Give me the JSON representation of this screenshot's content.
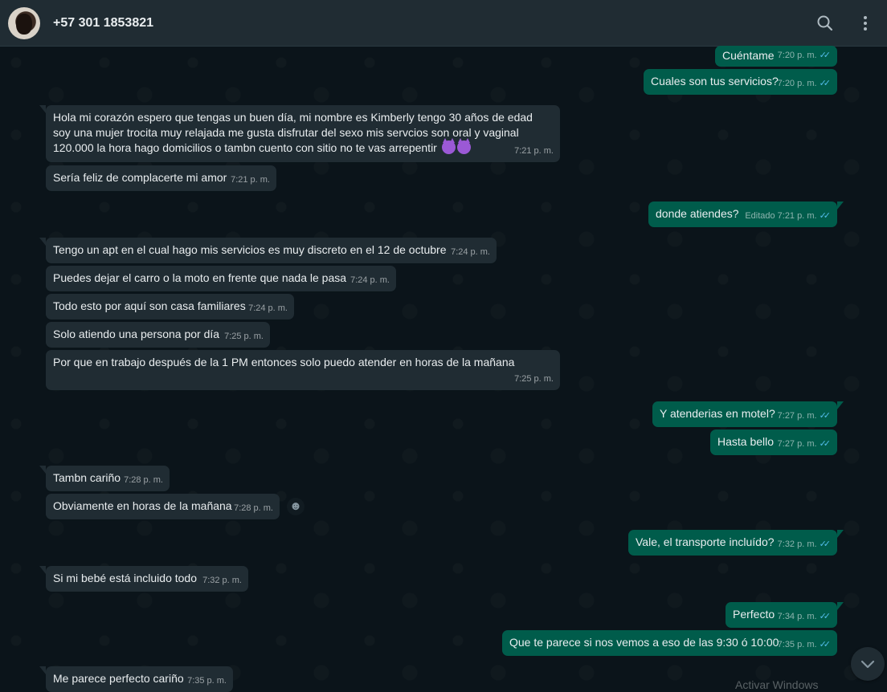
{
  "header": {
    "contact_name": "+57 301 1853821",
    "icons": [
      "search-icon",
      "menu-icon"
    ]
  },
  "messages": [
    {
      "dir": "out",
      "text": "Cuéntame",
      "time": "7:20 p. m."
    },
    {
      "dir": "out",
      "text": "Cuales son tus servicios?",
      "time": "7:20 p. m."
    },
    {
      "dir": "in",
      "text": "Hola mi corazón espero que tengas un buen día, mi nombre es Kimberly tengo 30 años de edad soy una mujer trocita muy relajada me gusta disfrutar del sexo mis servcios son oral y vaginal 120.000 la hora hago domicilios o tambn cuento con sitio no te vas arrepentir",
      "time": "7:21 p. m.",
      "emoji": "smiling-devil-icon"
    },
    {
      "dir": "in",
      "text": "Sería feliz de complacerte mi amor",
      "time": "7:21 p. m."
    },
    {
      "dir": "out",
      "text": "donde atiendes?",
      "time": "7:21 p. m.",
      "edited": "Editado"
    },
    {
      "dir": "in",
      "text": "Tengo un apt en el cual hago mis servicios es muy discreto en el 12 de octubre",
      "time": "7:24 p. m."
    },
    {
      "dir": "in",
      "text": "Puedes dejar el carro o la moto en frente que nada le pasa",
      "time": "7:24 p. m."
    },
    {
      "dir": "in",
      "text": "Todo esto por aquí son casa familiares",
      "time": "7:24 p. m."
    },
    {
      "dir": "in",
      "text": "Solo atiendo una persona por día",
      "time": "7:25 p. m."
    },
    {
      "dir": "in",
      "text": "Por que en trabajo después de la 1 PM entonces solo puedo atender en horas de la mañana",
      "time": "7:25 p. m."
    },
    {
      "dir": "out",
      "text": "Y atenderias en motel?",
      "time": "7:27 p. m."
    },
    {
      "dir": "out",
      "text": "Hasta bello",
      "time": "7:27 p. m."
    },
    {
      "dir": "in",
      "text": "Tambn cariño",
      "time": "7:28 p. m."
    },
    {
      "dir": "in",
      "text": "Obviamente en horas de la mañana",
      "time": "7:28 p. m."
    },
    {
      "dir": "out",
      "text": "Vale, el transporte incluído?",
      "time": "7:32 p. m."
    },
    {
      "dir": "in",
      "text": "Si mi bebé está incluido todo",
      "time": "7:32 p. m."
    },
    {
      "dir": "out",
      "text": "Perfecto",
      "time": "7:34 p. m."
    },
    {
      "dir": "out",
      "text": "Que te parece si nos vemos a eso de las 9:30 ó 10:00",
      "time": "7:35 p. m."
    },
    {
      "dir": "in",
      "text": "Me parece perfecto cariño",
      "time": "7:35 p. m."
    }
  ],
  "watermark_partial": "Activar Windows",
  "colors": {
    "incoming": "#202c33",
    "outgoing": "#005c4b",
    "read_ticks": "#53bdeb",
    "background": "#0b141a"
  }
}
